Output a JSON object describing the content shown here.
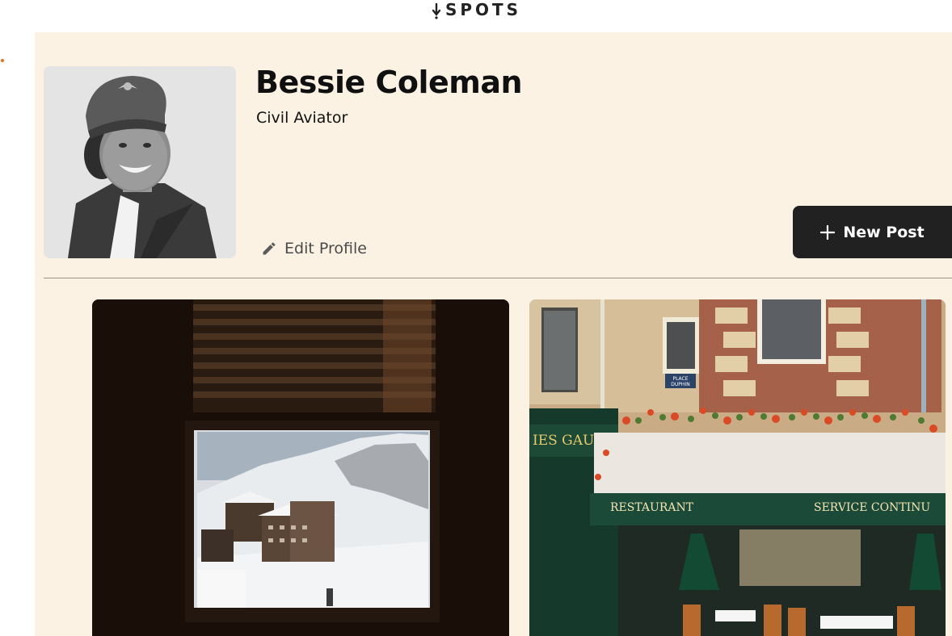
{
  "app": {
    "name": "SPOTS"
  },
  "profile": {
    "name": "Bessie Coleman",
    "description": "Civil Aviator",
    "edit_label": "Edit Profile",
    "new_post_label": "New Post"
  },
  "cards": [
    {
      "id": "card-1"
    },
    {
      "id": "card-2",
      "signs": {
        "brand": "IES GAUBERT",
        "left_awning": "RESTAURANT",
        "right_awning": "SERVICE CONTINU",
        "plaque_top": "PLACE",
        "plaque_bottom": "DUPHIN"
      }
    }
  ],
  "colors": {
    "accent": "#e8711a",
    "background": "#fbf2e4",
    "button": "#212121",
    "text": "#101010"
  }
}
